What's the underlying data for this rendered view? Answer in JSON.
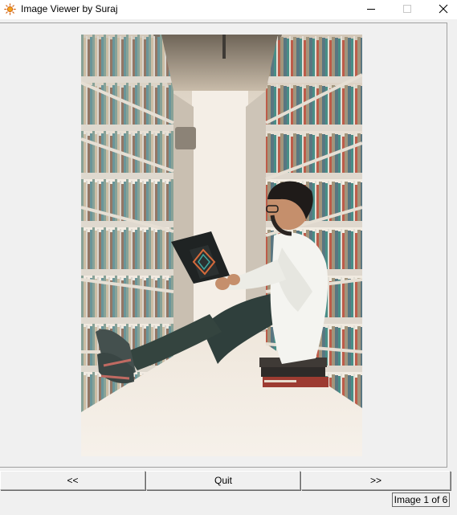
{
  "window": {
    "title": "Image Viewer by Suraj",
    "icon": "sun-icon"
  },
  "controls": {
    "minimize_icon": "minimize-icon",
    "maximize_icon": "maximize-icon",
    "close_icon": "close-icon"
  },
  "viewer": {
    "image_subject": "photo-man-reading-in-library"
  },
  "buttons": {
    "back_label": "<<",
    "quit_label": "Quit",
    "forward_label": ">>"
  },
  "status": {
    "text": "Image 1 of 6"
  },
  "colors": {
    "window_bg": "#f0f0f0",
    "titlebar_bg": "#ffffff",
    "shelf_wood": "#e8e0d4",
    "jeans": "#2f3f3c",
    "shirt": "#f4f4f0"
  }
}
